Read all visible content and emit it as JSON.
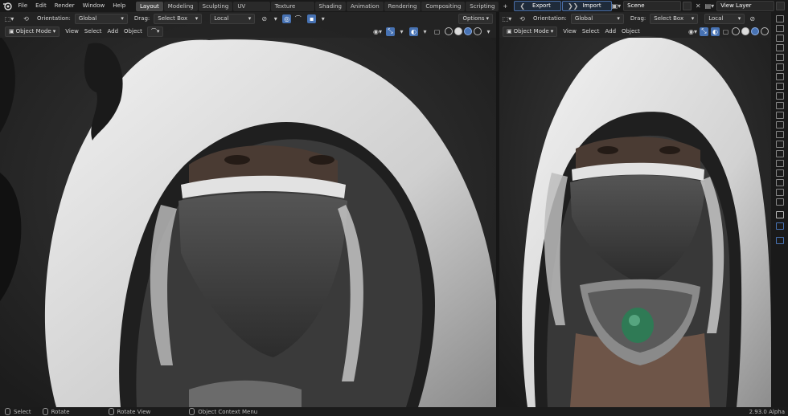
{
  "topbar": {
    "menu": [
      "File",
      "Edit",
      "Render",
      "Window",
      "Help"
    ],
    "workspaces": [
      {
        "label": "Layout",
        "active": true
      },
      {
        "label": "Modeling"
      },
      {
        "label": "Sculpting"
      },
      {
        "label": "UV Editing"
      },
      {
        "label": "Texture Paint"
      },
      {
        "label": "Shading"
      },
      {
        "label": "Animation"
      },
      {
        "label": "Rendering"
      },
      {
        "label": "Compositing"
      },
      {
        "label": "Scripting"
      }
    ],
    "add_workspace": "+",
    "export_label": "Export",
    "import_label": "Import",
    "scene_value": "Scene",
    "view_layer_value": "View Layer"
  },
  "viewport_header": {
    "orientation_label": "Orientation:",
    "orientation_value": "Global",
    "drag_label": "Drag:",
    "drag_value": "Select Box",
    "pivot_value": "Local",
    "options_label": "Options",
    "mode_value": "Object Mode",
    "view_menu": "View",
    "select_menu": "Select",
    "add_menu": "Add",
    "object_menu": "Object"
  },
  "statusbar": {
    "select": "Select",
    "rotate": "Rotate",
    "rotate_view": "Rotate View",
    "context_menu": "Object Context Menu",
    "version": "2.93.0 Alpha"
  },
  "colors": {
    "accent": "#4772b3",
    "background": "#1d1d1d",
    "hood_white": "#d9d9d9",
    "gem_green": "#2f7a55"
  }
}
